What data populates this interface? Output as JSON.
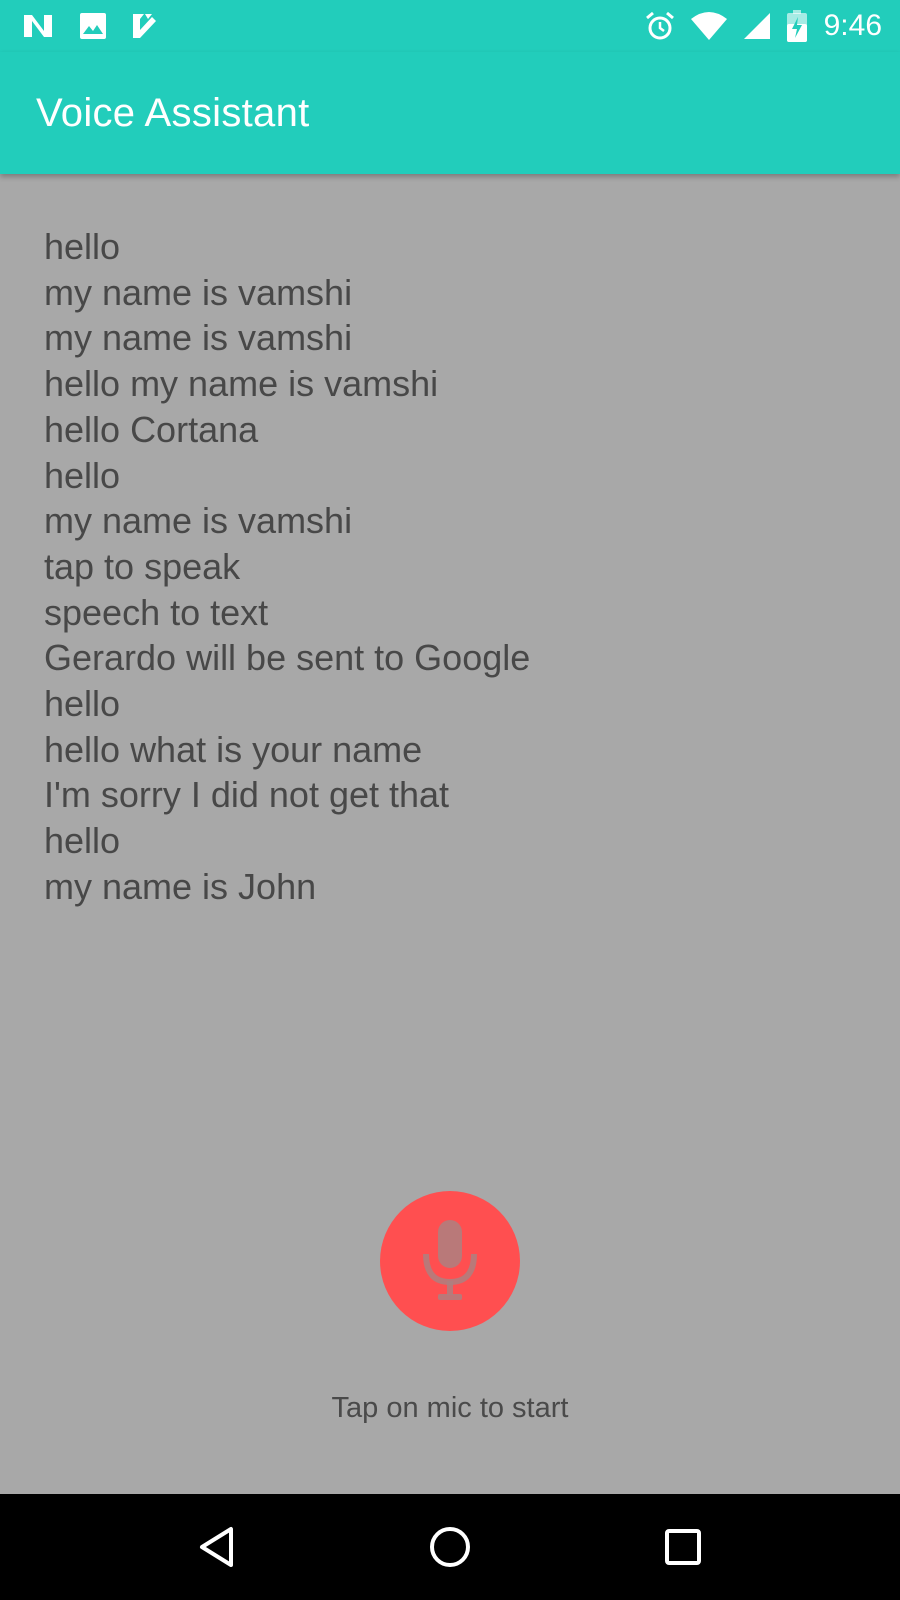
{
  "status_bar": {
    "time": "9:46",
    "left_icons": [
      "n-notification-icon",
      "image-notification-icon",
      "check-notification-icon"
    ],
    "right_icons": [
      "alarm-icon",
      "wifi-icon",
      "signal-icon",
      "battery-charging-icon"
    ]
  },
  "app_bar": {
    "title": "Voice Assistant"
  },
  "transcript": {
    "lines": [
      "hello",
      "my name is vamshi",
      "my name is vamshi",
      "hello my name is vamshi",
      "hello Cortana",
      "hello",
      "my name is vamshi",
      "tap to speak",
      "speech to text",
      "Gerardo will be sent to Google",
      "hello",
      "hello what is your name",
      "I'm sorry I did not get that",
      "hello",
      "my name is John"
    ]
  },
  "mic": {
    "icon": "microphone-icon",
    "hint": "Tap on mic to start"
  },
  "nav_bar": {
    "icons": [
      "back-icon",
      "home-icon",
      "recents-icon"
    ]
  },
  "colors": {
    "primary": "#22cdbb",
    "background": "#a8a8a8",
    "mic_button": "#ff4f50",
    "text": "#484848"
  }
}
